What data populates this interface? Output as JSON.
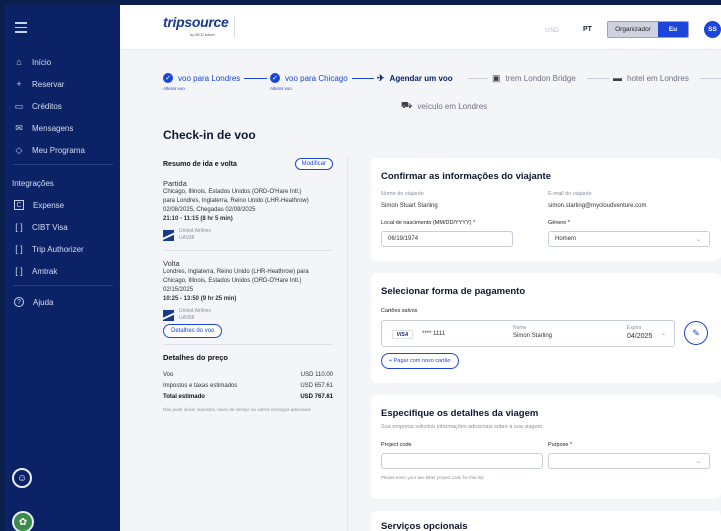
{
  "sidebar": {
    "items": [
      {
        "icon": "home-icon",
        "glyph": "⌂",
        "label": "Início"
      },
      {
        "icon": "plus-icon",
        "glyph": "+",
        "label": "Reservar"
      },
      {
        "icon": "credit-icon",
        "glyph": "▭",
        "label": "Créditos"
      },
      {
        "icon": "mail-icon",
        "glyph": "✉",
        "label": "Mensagens"
      },
      {
        "icon": "shield-icon",
        "glyph": "◇",
        "label": "Meu Programa"
      }
    ],
    "integrations_label": "Integrações",
    "integrations": [
      {
        "icon": "expense-icon",
        "glyph": "C",
        "label": "Expense"
      },
      {
        "icon": "bracket-icon",
        "glyph": "⁅⁆",
        "label": "CIBT Visa"
      },
      {
        "icon": "bracket-icon",
        "glyph": "⁅⁆",
        "label": "Trip Authorizer"
      },
      {
        "icon": "bracket-icon",
        "glyph": "⁅⁆",
        "label": "Amtrak"
      }
    ],
    "help": {
      "icon": "help-icon",
      "glyph": "?",
      "label": "Ajuda"
    }
  },
  "header": {
    "logo": "tripsource",
    "logo_sub": "by BCD travel",
    "currency": "USD",
    "language": "PT",
    "role_organizer": "Organizador",
    "role_me": "Eu",
    "avatar": "SS"
  },
  "stepper": {
    "steps": [
      {
        "label": "voo para Londres",
        "alter": "Alterar voo"
      },
      {
        "label": "voo para Chicago",
        "alter": "Alterar voo"
      },
      {
        "label": "Agendar um voo"
      },
      {
        "label": "trem London Bridge"
      },
      {
        "label": "hotel em Londres"
      },
      {
        "label": "veículo em Londres"
      }
    ]
  },
  "page_title": "Check-in de voo",
  "summary": {
    "title": "Resumo de ida e volta",
    "modify": "Modificar",
    "outbound": {
      "title": "Partida",
      "from": "Chicago, Illinois, Estados Unidos (ORD-O'Hare Intl.)",
      "to": "para Londres, Inglaterra, Reino Unido (LHR-Heathrow)",
      "dates": "02/08/2025, Chegadas 02/09/2025",
      "time": "21:10 - 11:15 (8 hr 5 min)",
      "airline": "United Airlines",
      "flight": "UA938"
    },
    "return": {
      "title": "Volta",
      "from": "Londres, Inglaterra, Reino Unido (LHR-Heathrow) para",
      "to": "Chicago, Illinois, Estados Unidos (ORD-O'Hare Intl.)",
      "dates": "02/15/2025",
      "time": "10:25 - 13:50 (9 hr 25 min)",
      "airline": "United Airlines",
      "flight": "UA958"
    },
    "details_btn": "Detalhes do voo",
    "price_title": "Detalhes do preço",
    "price_rows": [
      {
        "label": "Voo",
        "value": "USD 110.00"
      },
      {
        "label": "Impostos e taxas estimados",
        "value": "USD 657.61"
      },
      {
        "label": "Total estimado",
        "value": "USD 767.61"
      }
    ],
    "price_note": "Não pode incluir impostos, taxas de serviço ou outros encargos adicionais"
  },
  "traveler": {
    "title": "Confirmar as informações do viajante",
    "name_label": "Nome do viajante",
    "name": "Simon Stuart Starling",
    "email_label": "E-mail do viajante",
    "email": "simon.starling@mycloudventure.com",
    "birthplace_label": "Local de nascimento (MM/DD/YYYY) *",
    "birthplace": "06/19/1974",
    "gender_label": "Gênero *",
    "gender": "Homem"
  },
  "payment": {
    "title": "Selecionar forma de pagamento",
    "saved_label": "Cartões salvos",
    "card_brand": "VISA",
    "card_number": "**** 1111",
    "name_label": "Nome",
    "name": "Simon Starling",
    "expiry_label": "Expira",
    "expiry": "04/2025",
    "add_card": "+ Pagar com novo cartão"
  },
  "trip_details": {
    "title": "Especifique os detalhes da viagem",
    "subtitle": "Sua empresa solicitou informações adicionais sobre a sua viagem.",
    "project_label": "Project code",
    "purpose_label": "Purpose *",
    "project_hint": "Please enter your two letter project code for this trip"
  },
  "optional": {
    "title": "Serviços opcionais"
  },
  "colors": {
    "sidebar_bg": "#0b2366",
    "accent": "#1b46d9",
    "page_bg": "#f4f5f8"
  }
}
